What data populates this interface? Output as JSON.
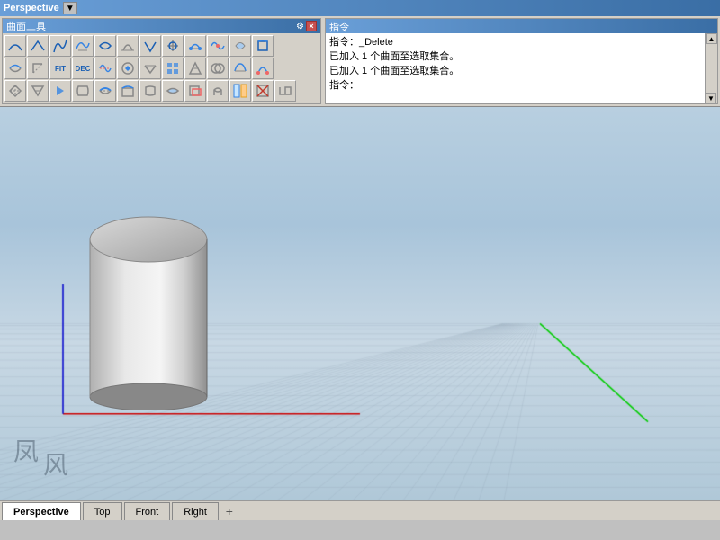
{
  "titlebar": {
    "label": "Perspective"
  },
  "curveTools": {
    "title": "曲面工具",
    "closeLabel": "×",
    "settingsLabel": "⚙"
  },
  "commandPanel": {
    "title": "指令",
    "lines": [
      "指令：_Delete",
      "已加入 1 个曲面至选取集合。",
      "已加入 1 个曲面至选取集合。",
      "指令："
    ]
  },
  "tabs": [
    {
      "label": "Perspective",
      "active": true
    },
    {
      "label": "Top",
      "active": false
    },
    {
      "label": "Front",
      "active": false
    },
    {
      "label": "Right",
      "active": false
    }
  ],
  "tabAdd": "+"
}
